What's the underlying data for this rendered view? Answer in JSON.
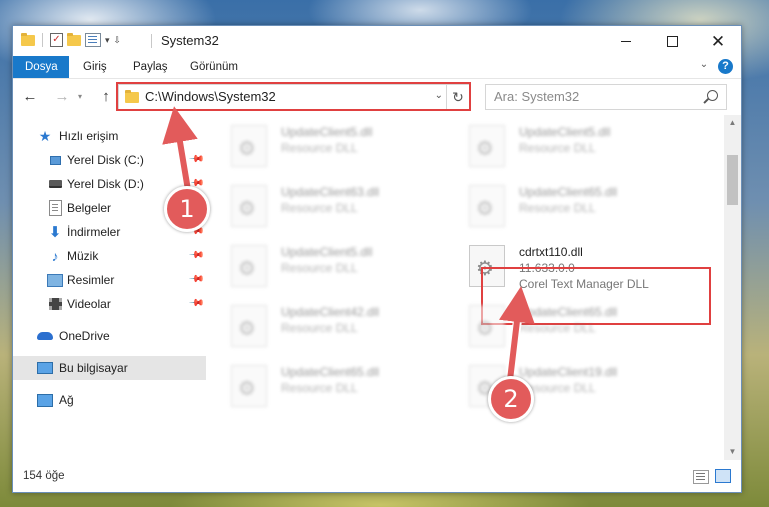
{
  "window": {
    "title": "System32"
  },
  "ribbon": {
    "tabs": [
      "Dosya",
      "Giriş",
      "Paylaş",
      "Görünüm"
    ]
  },
  "address": {
    "path": "C:\\Windows\\System32"
  },
  "search": {
    "placeholder": "Ara: System32"
  },
  "sidebar": {
    "items": [
      {
        "label": "Hızlı erişim",
        "icon": "star-icon"
      },
      {
        "label": "Yerel Disk (C:)",
        "icon": "disk-icon",
        "pinned": true
      },
      {
        "label": "Yerel Disk (D:)",
        "icon": "disk-icon",
        "pinned": true
      },
      {
        "label": "Belgeler",
        "icon": "document-icon",
        "pinned": true
      },
      {
        "label": "İndirmeler",
        "icon": "download-icon",
        "pinned": true
      },
      {
        "label": "Müzik",
        "icon": "music-icon",
        "pinned": true
      },
      {
        "label": "Resimler",
        "icon": "pictures-icon",
        "pinned": true
      },
      {
        "label": "Videolar",
        "icon": "video-icon",
        "pinned": true
      },
      {
        "label": "OneDrive",
        "icon": "onedrive-icon"
      },
      {
        "label": "Bu bilgisayar",
        "icon": "computer-icon",
        "selected": true
      },
      {
        "label": "Ağ",
        "icon": "network-icon"
      }
    ]
  },
  "files": [
    {
      "name": "UpdateClient5.dll",
      "type": "Resource DLL"
    },
    {
      "name": "UpdateClient5.dll",
      "type": "Resource DLL"
    },
    {
      "name": "UpdateClient63.dll",
      "type": "Resource DLL"
    },
    {
      "name": "UpdateClient65.dll",
      "type": "Resource DLL"
    },
    {
      "name": "UpdateClient5.dll",
      "type": "Resource DLL"
    },
    {
      "name": "cdrtxt110.dll",
      "version": "11.633.0.0",
      "description": "Corel Text Manager DLL"
    },
    {
      "name": "UpdateClient42.dll",
      "type": "Resource DLL"
    },
    {
      "name": "UpdateClient65.dll",
      "type": "Resource DLL"
    },
    {
      "name": "UpdateClient65.dll",
      "type": "Resource DLL"
    },
    {
      "name": "UpdateClient19.dll",
      "type": "Resource DLL"
    }
  ],
  "status": {
    "item_count": "154 öğe"
  },
  "annotations": {
    "step1": "1",
    "step2": "2"
  },
  "colors": {
    "accent": "#1979ca",
    "annotation": "#e25b5b"
  }
}
